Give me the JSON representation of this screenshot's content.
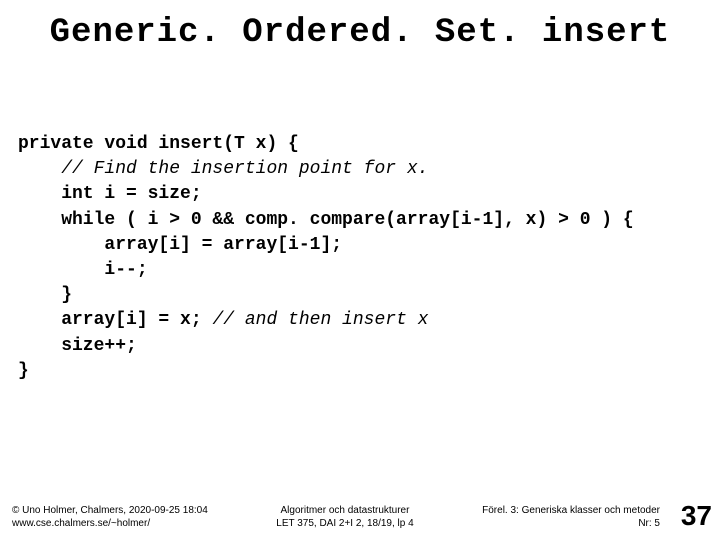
{
  "title": "Generic. Ordered. Set. insert",
  "code": {
    "l1": "private void insert(T x) {",
    "l2_comment": "    // Find the insertion point for x.",
    "l3": "    int i = size;",
    "l4": "    while ( i > 0 && comp. compare(array[i-1], x) > 0 ) {",
    "l5": "        array[i] = array[i-1];",
    "l6": "        i--;",
    "l7": "    }",
    "l8a": "    array[i] = x; ",
    "l8b_comment": "// and then insert x",
    "l9": "    size++;",
    "l10": "}"
  },
  "footer": {
    "left_line1": "© Uno Holmer, Chalmers, 2020-09-25 18:04",
    "left_line2": "www.cse.chalmers.se/~holmer/",
    "center_line1": "Algoritmer och datastrukturer",
    "center_line2": "LET 375, DAI 2+I 2, 18/19, lp 4",
    "right_line1": "Förel. 3: Generiska klasser och metoder",
    "right_line2": "Nr: 5",
    "page_number": "37"
  }
}
